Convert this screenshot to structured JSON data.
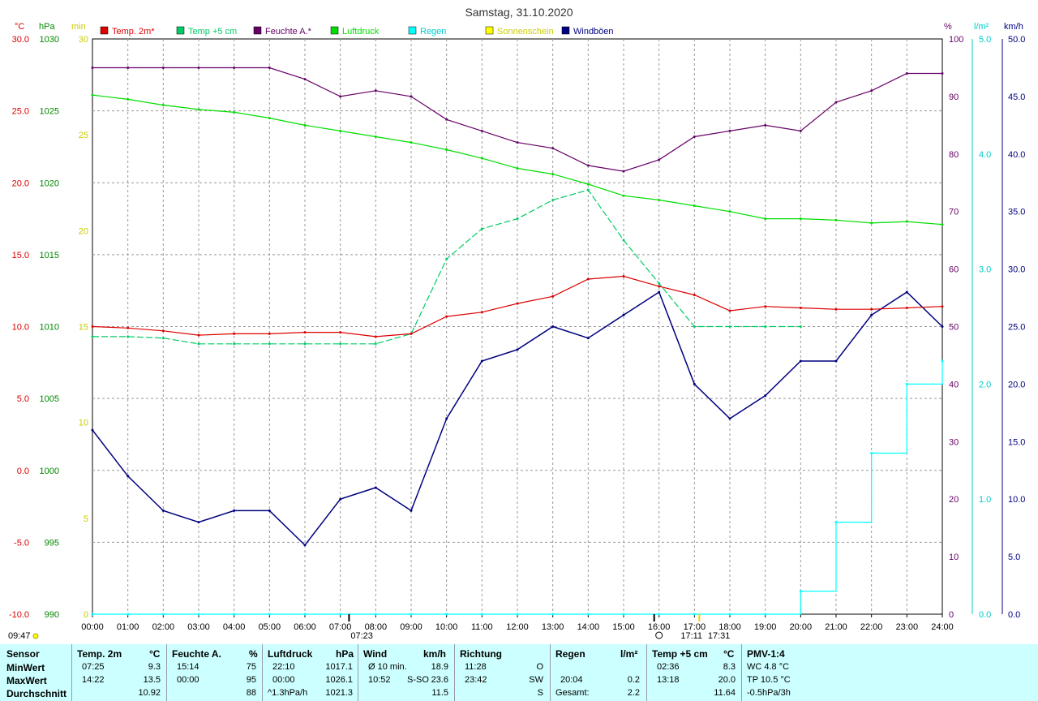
{
  "title": "Samstag, 31.10.2020",
  "colors": {
    "temp2m": "#dd0000",
    "temp5cm": "#00cc66",
    "humidity": "#660066",
    "pressure": "#00dd00",
    "rain": "#00ffff",
    "sunshine": "#ffff00",
    "gusts": "#000080",
    "table_bg": "#ccffff"
  },
  "legend": [
    {
      "label": "Temp. 2m*",
      "color": "#dd0000"
    },
    {
      "label": "Temp +5 cm",
      "color": "#00cc66"
    },
    {
      "label": "Feuchte A.*",
      "color": "#660066"
    },
    {
      "label": "Luftdruck",
      "color": "#00dd00"
    },
    {
      "label": "Regen",
      "color": "#00ffff"
    },
    {
      "label": "Sonnenschein",
      "color": "#ffff00"
    },
    {
      "label": "Windböen",
      "color": "#000080"
    }
  ],
  "axis_units": {
    "temp": "°C",
    "pressure": "hPa",
    "sun": "min",
    "humidity": "%",
    "rain": "l/m²",
    "wind": "km/h"
  },
  "x_ticks": [
    "00:00",
    "01:00",
    "02:00",
    "03:00",
    "04:00",
    "05:00",
    "06:00",
    "07:00",
    "08:00",
    "09:00",
    "10:00",
    "11:00",
    "12:00",
    "13:00",
    "14:00",
    "15:00",
    "16:00",
    "17:00",
    "18:00",
    "19:00",
    "20:00",
    "21:00",
    "22:00",
    "23:00",
    "24:00"
  ],
  "sun_markers": {
    "now": "09:47",
    "sunrise": "07:23",
    "moon": "16:00",
    "sunset": "17:11",
    "twilight": "17:31"
  },
  "chart_data": {
    "type": "line",
    "x": [
      "00:00",
      "01:00",
      "02:00",
      "03:00",
      "04:00",
      "05:00",
      "06:00",
      "07:00",
      "08:00",
      "09:00",
      "10:00",
      "11:00",
      "12:00",
      "13:00",
      "14:00",
      "15:00",
      "16:00",
      "17:00",
      "18:00",
      "19:00",
      "20:00",
      "21:00",
      "22:00",
      "23:00",
      "24:00"
    ],
    "axes": {
      "temp": {
        "unit": "°C",
        "ylim": [
          -10,
          30
        ],
        "ticks": [
          -10,
          -5,
          0,
          5,
          10,
          15,
          20,
          25,
          30
        ]
      },
      "pressure": {
        "unit": "hPa",
        "ylim": [
          990,
          1030
        ],
        "ticks": [
          990,
          995,
          1000,
          1005,
          1010,
          1015,
          1020,
          1025,
          1030
        ]
      },
      "sunshine": {
        "unit": "min",
        "ylim": [
          0,
          30
        ],
        "ticks": [
          0,
          5,
          10,
          15,
          20,
          25,
          30
        ]
      },
      "humidity": {
        "unit": "%",
        "ylim": [
          0,
          100
        ],
        "ticks": [
          0,
          10,
          20,
          30,
          40,
          50,
          60,
          70,
          80,
          90,
          100
        ]
      },
      "rain": {
        "unit": "l/m²",
        "ylim": [
          0,
          5
        ],
        "ticks": [
          0.0,
          1.0,
          2.0,
          3.0,
          4.0,
          5.0
        ]
      },
      "wind": {
        "unit": "km/h",
        "ylim": [
          0,
          50
        ],
        "ticks": [
          0.0,
          5.0,
          10.0,
          15.0,
          20.0,
          25.0,
          30.0,
          35.0,
          40.0,
          45.0,
          50.0
        ]
      }
    },
    "series": [
      {
        "name": "Temp. 2m*",
        "axis": "temp",
        "values": [
          10.0,
          9.9,
          9.7,
          9.4,
          9.5,
          9.5,
          9.6,
          9.6,
          9.3,
          9.5,
          10.7,
          11.0,
          11.6,
          12.1,
          13.3,
          13.5,
          12.8,
          12.2,
          11.1,
          11.4,
          11.3,
          11.2,
          11.2,
          11.3,
          11.4
        ]
      },
      {
        "name": "Temp +5 cm",
        "axis": "temp",
        "values": [
          9.3,
          9.3,
          9.2,
          8.8,
          8.8,
          8.8,
          8.8,
          8.8,
          8.8,
          9.5,
          14.7,
          16.8,
          17.5,
          18.8,
          19.5,
          16.0,
          13.0,
          10.0,
          10.0,
          10.0,
          10.0,
          null,
          null,
          null,
          null
        ]
      },
      {
        "name": "Feuchte A.*",
        "axis": "humidity",
        "values": [
          95,
          95,
          95,
          95,
          95,
          95,
          93,
          90,
          91,
          90,
          86,
          84,
          82,
          81,
          78,
          77,
          79,
          83,
          84,
          85,
          84,
          89,
          91,
          94,
          94
        ]
      },
      {
        "name": "Luftdruck",
        "axis": "pressure",
        "values": [
          1026.1,
          1025.8,
          1025.4,
          1025.1,
          1024.9,
          1024.5,
          1024.0,
          1023.6,
          1023.2,
          1022.8,
          1022.3,
          1021.7,
          1021.0,
          1020.6,
          1019.9,
          1019.1,
          1018.8,
          1018.4,
          1018.0,
          1017.5,
          1017.5,
          1017.4,
          1017.2,
          1017.3,
          1017.1
        ]
      },
      {
        "name": "Regen",
        "axis": "rain",
        "values": [
          0,
          0,
          0,
          0,
          0,
          0,
          0,
          0,
          0,
          0,
          0,
          0,
          0,
          0,
          0,
          0,
          0,
          0,
          0,
          0,
          0.2,
          0.8,
          1.4,
          2.0,
          2.2
        ]
      },
      {
        "name": "Windböen",
        "axis": "wind",
        "values": [
          16,
          12,
          9,
          8,
          9,
          9,
          6,
          10,
          11,
          9,
          17,
          22,
          23,
          25,
          24,
          26,
          28,
          20,
          17,
          19,
          22,
          22,
          26,
          28,
          25
        ]
      }
    ]
  },
  "table": {
    "row_labels": [
      "Sensor",
      "MinWert",
      "MaxWert",
      "Durchschnitt"
    ],
    "temp2m": {
      "title": "Temp. 2m",
      "unit": "°C",
      "min_time": "07:25",
      "min": "9.3",
      "max_time": "14:22",
      "max": "13.5",
      "avg": "10.92"
    },
    "humidity": {
      "title": "Feuchte A.",
      "unit": "%",
      "min_time": "15:14",
      "min": "75",
      "max_time": "00:00",
      "max": "95",
      "avg": "88"
    },
    "pressure": {
      "title": "Luftdruck",
      "unit": "hPa",
      "min_time": "22:10",
      "min": "1017.1",
      "max_time": "00:00",
      "max": "1026.1",
      "trend": "^1.3hPa/h",
      "avg": "1021.3"
    },
    "wind": {
      "title": "Wind",
      "unit": "km/h",
      "avg_label": "Ø 10 min.",
      "avg10": "18.9",
      "max_time": "10:52",
      "max_dir": "S-SO",
      "max": "23.6",
      "avg": "11.5"
    },
    "direction": {
      "title": "Richtung",
      "t1": "11:28",
      "d1": "O",
      "t2": "23:42",
      "d2": "SW",
      "avg": "S"
    },
    "rain": {
      "title": "Regen",
      "unit": "l/m²",
      "max_time": "20:04",
      "max": "0.2",
      "total_label": "Gesamt:",
      "total": "2.2"
    },
    "temp5": {
      "title": "Temp +5 cm",
      "unit": "°C",
      "min_time": "02:36",
      "min": "8.3",
      "max_time": "13:18",
      "max": "20.0",
      "avg": "11.64"
    },
    "pmv": {
      "title": "PMV-1:4",
      "wc": "WC 4.8 °C",
      "tp": "TP 10.5 °C",
      "trend": "-0.5hPa/3h"
    }
  }
}
